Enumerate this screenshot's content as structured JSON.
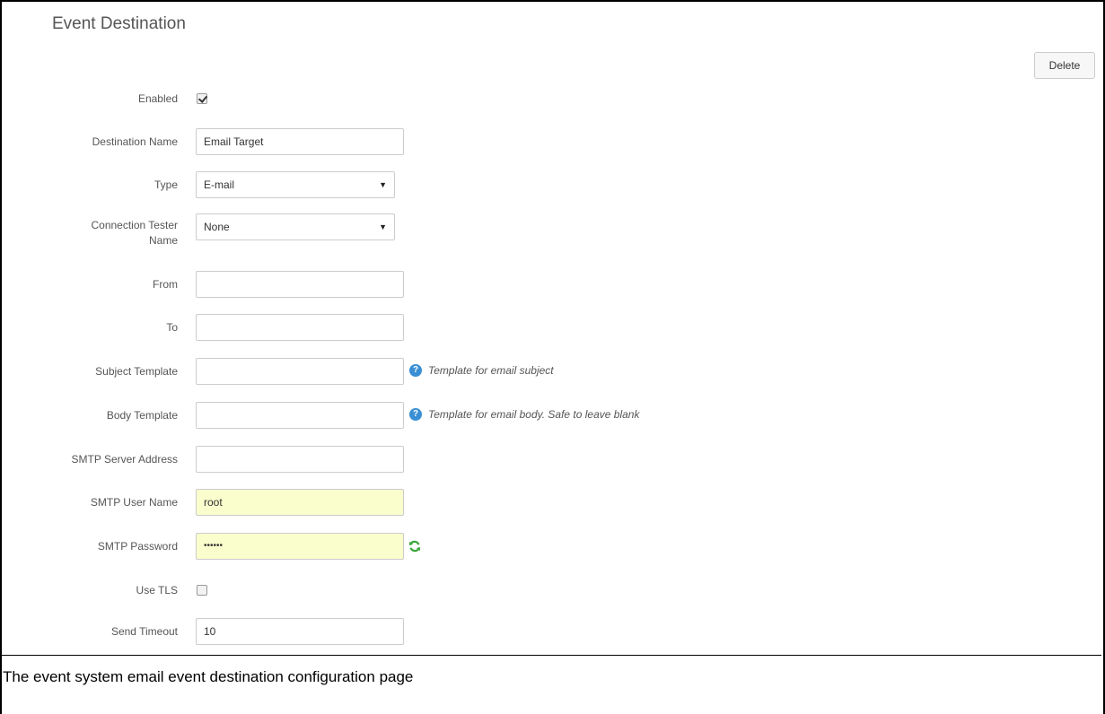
{
  "page": {
    "title": "Event Destination",
    "delete_label": "Delete",
    "caption": "The event system email event destination configuration page"
  },
  "form": {
    "enabled": {
      "label": "Enabled",
      "checked": true
    },
    "destination_name": {
      "label": "Destination Name",
      "value": "Email Target"
    },
    "type": {
      "label": "Type",
      "value": "E-mail"
    },
    "connection_tester": {
      "label_line1": "Connection Tester",
      "label_line2": "Name",
      "value": "None"
    },
    "from": {
      "label": "From",
      "value": ""
    },
    "to": {
      "label": "To",
      "value": ""
    },
    "subject_template": {
      "label": "Subject Template",
      "value": "",
      "help": "Template for email subject"
    },
    "body_template": {
      "label": "Body Template",
      "value": "",
      "help": "Template for email body. Safe to leave blank"
    },
    "smtp_server": {
      "label": "SMTP Server Address",
      "value": ""
    },
    "smtp_user": {
      "label": "SMTP User Name",
      "value": "root"
    },
    "smtp_password": {
      "label": "SMTP Password",
      "value": "••••••"
    },
    "use_tls": {
      "label": "Use TLS",
      "checked": false
    },
    "send_timeout": {
      "label": "Send Timeout",
      "value": "10"
    }
  },
  "icons": {
    "help": "question-circle-icon",
    "refresh": "refresh-icon",
    "dropdown": "caret-down-icon"
  },
  "colors": {
    "autofill_bg": "#fafdcc",
    "help_icon": "#3a8fd4",
    "refresh_icon": "#3aa63a"
  }
}
